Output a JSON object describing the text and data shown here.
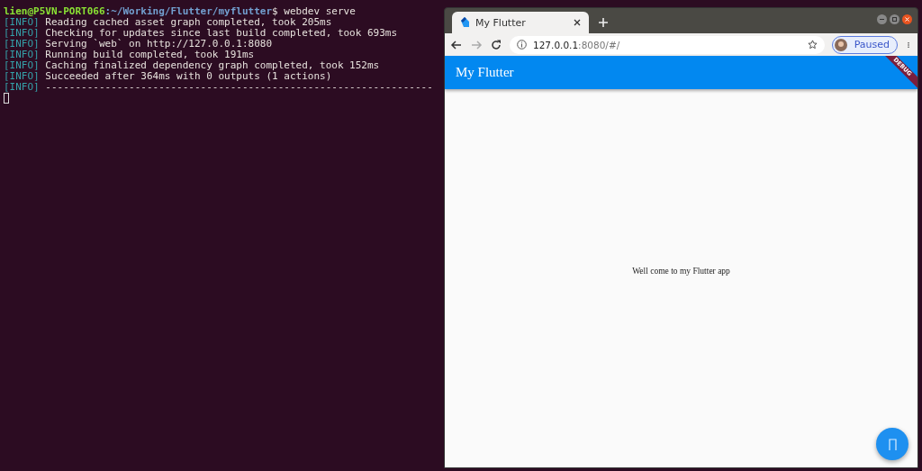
{
  "terminal": {
    "prompt_user": "lien@P5VN-PORT066",
    "prompt_path": ":~/Working/Flutter/myflutter",
    "prompt_symbol": "$",
    "command": "webdev serve",
    "lines": [
      {
        "tag": "[INFO]",
        "text": "Reading cached asset graph completed, took 205ms"
      },
      {
        "tag": "[INFO]",
        "text": "Checking for updates since last build completed, took 693ms"
      },
      {
        "tag": "[INFO]",
        "text": "Serving `web` on http://127.0.0.1:8080"
      },
      {
        "tag": "[INFO]",
        "text": "Running build completed, took 191ms"
      },
      {
        "tag": "[INFO]",
        "text": "Caching finalized dependency graph completed, took 152ms"
      },
      {
        "tag": "[INFO]",
        "text": "Succeeded after 364ms with 0 outputs (1 actions)"
      },
      {
        "tag": "[INFO]",
        "text": "-----------------------------------------------------------------"
      }
    ]
  },
  "browser": {
    "tab": {
      "title": "My Flutter",
      "selected": true
    },
    "url": {
      "host": "127.0.0.1",
      "rest": ":8080/#/"
    },
    "profile": {
      "label": "Paused"
    },
    "app": {
      "title": "My Flutter",
      "banner": "DEBUG",
      "body_text": "Well come to my Flutter app"
    }
  }
}
